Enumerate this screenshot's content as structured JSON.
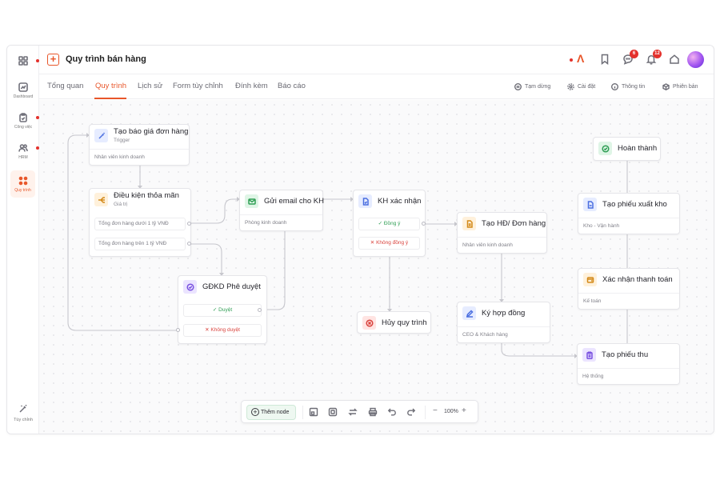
{
  "app": {
    "title": "Quy trình bán hàng",
    "accent_color": "#e8562a",
    "add_icon": "plus-square-icon"
  },
  "rail": {
    "items": [
      {
        "label": "",
        "icon": "grid-icon"
      },
      {
        "label": "Dashboard",
        "icon": "dashboard-icon"
      },
      {
        "label": "Công việc",
        "icon": "clipboard-icon"
      },
      {
        "label": "HRM",
        "icon": "users-icon"
      },
      {
        "label": "Quy trình",
        "icon": "workflow-icon",
        "active": true
      }
    ],
    "footer": {
      "label": "Tùy chỉnh",
      "icon": "magic-wand-icon"
    }
  },
  "header": {
    "notifications": {
      "messages": "6",
      "alerts": "12"
    }
  },
  "tabs": [
    {
      "label": "Tổng quan"
    },
    {
      "label": "Quy trình",
      "active": true
    },
    {
      "label": "Lịch sử"
    },
    {
      "label": "Form tùy chỉnh"
    },
    {
      "label": "Đính kèm"
    },
    {
      "label": "Báo cáo"
    }
  ],
  "actions": {
    "pause": "Tạm dừng",
    "settings": "Cài đặt",
    "info": "Thông tin",
    "version": "Phiên bản"
  },
  "nodes": {
    "quote": {
      "title": "Tạo báo giá đơn hàng",
      "subtitle": "Trigger",
      "owner": "Nhân viên kinh doanh"
    },
    "condition": {
      "title": "Điều kiện thỏa mãn",
      "subtitle": "Giá trị",
      "cond1": "Tổng đơn hàng dưới 1 tỷ VNĐ",
      "cond2": "Tổng đơn hàng trên 1 tỷ VNĐ"
    },
    "email": {
      "title": "Gửi email cho KH",
      "owner": "Phòng kinh doanh"
    },
    "confirm": {
      "title": "KH xác nhận",
      "ok": "Đồng ý",
      "no": "Không đồng ý"
    },
    "approve": {
      "title": "GĐKD Phê duyệt",
      "ok": "Duyệt",
      "no": "Không duyệt"
    },
    "cancel": {
      "title": "Hủy quy trình"
    },
    "contract": {
      "title": "Tạo HĐ/ Đơn hàng",
      "owner": "Nhân viên kinh doanh"
    },
    "sign": {
      "title": "Ký hợp đồng",
      "owner": "CEO & Khách hàng"
    },
    "done": {
      "title": "Hoàn thành"
    },
    "export": {
      "title": "Tạo phiếu xuất kho",
      "owner": "Kho - Vận hành"
    },
    "payment": {
      "title": "Xác nhận thanh toán",
      "owner": "Kế toán"
    },
    "receipt": {
      "title": "Tạo phiếu thu",
      "owner": "Hệ thống"
    }
  },
  "toolbar": {
    "add_label": "Thêm node",
    "zoom": "100%",
    "zoom_minus": "−",
    "zoom_plus": "+"
  }
}
